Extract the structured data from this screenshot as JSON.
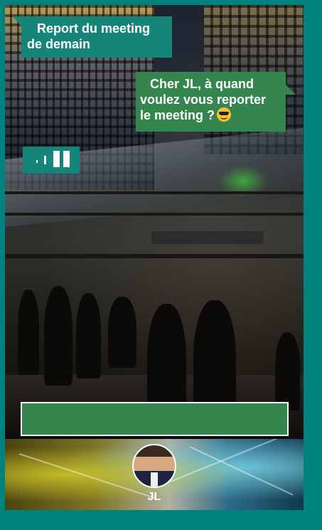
{
  "conversation": {
    "received_message": {
      "line1": "Report du meeting",
      "line2": "de demain"
    },
    "sent_message": {
      "line1": "Cher JL, à quand",
      "line2": "voulez vous reporter",
      "line3": "le meeting ?",
      "emoji": "smiling-face-with-sunglasses"
    },
    "audio_message": {
      "icon": "audio-waveform-icon"
    }
  },
  "composer": {
    "value": ""
  },
  "contact": {
    "name": "JL",
    "avatar": "profile-photo"
  },
  "colors": {
    "frame": "#00827f",
    "received_bubble": "#158479",
    "sent_bubble": "#34854e",
    "composer": "#34854e"
  }
}
